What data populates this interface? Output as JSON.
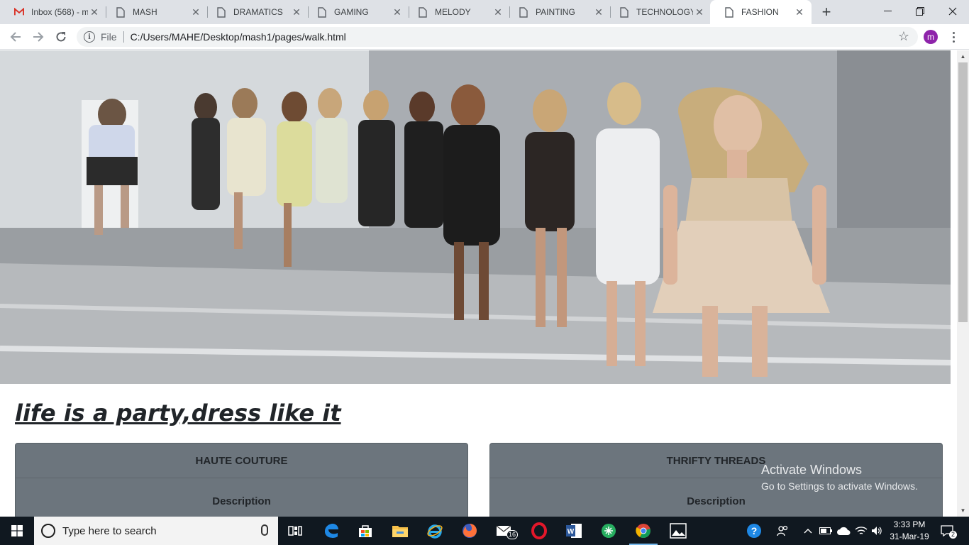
{
  "browser": {
    "tabs": [
      {
        "label": "Inbox (568) - m",
        "icon": "gmail-icon"
      },
      {
        "label": "MASH",
        "icon": "page-icon"
      },
      {
        "label": "DRAMATICS",
        "icon": "page-icon"
      },
      {
        "label": "GAMING",
        "icon": "page-icon"
      },
      {
        "label": "MELODY",
        "icon": "page-icon"
      },
      {
        "label": "PAINTING",
        "icon": "page-icon"
      },
      {
        "label": "TECHNOLOGY",
        "icon": "page-icon"
      },
      {
        "label": "FASHION",
        "icon": "page-icon",
        "active": true
      }
    ],
    "address": {
      "scheme_label": "File",
      "url": "C:/Users/MAHE/Desktop/mash1/pages/walk.html"
    },
    "profile_initial": "m"
  },
  "page": {
    "hero_image": "runway-models-photo",
    "tagline": "life is a party,dress like it",
    "cards": [
      {
        "title": "HAUTE COUTURE",
        "subtitle": "Description"
      },
      {
        "title": "THRIFTY THREADS",
        "subtitle": "Description"
      }
    ]
  },
  "watermark": {
    "line1": "Activate Windows",
    "line2": "Go to Settings to activate Windows."
  },
  "taskbar": {
    "search_placeholder": "Type here to search",
    "mail_badge": "16",
    "clock_time": "3:33 PM",
    "clock_date": "31-Mar-19",
    "notification_count": "2"
  },
  "colors": {
    "card_bg": "#6c757d",
    "taskbar_bg": "#101820",
    "tab_strip_bg": "#dee1e6",
    "avatar_bg": "#8e24aa"
  }
}
